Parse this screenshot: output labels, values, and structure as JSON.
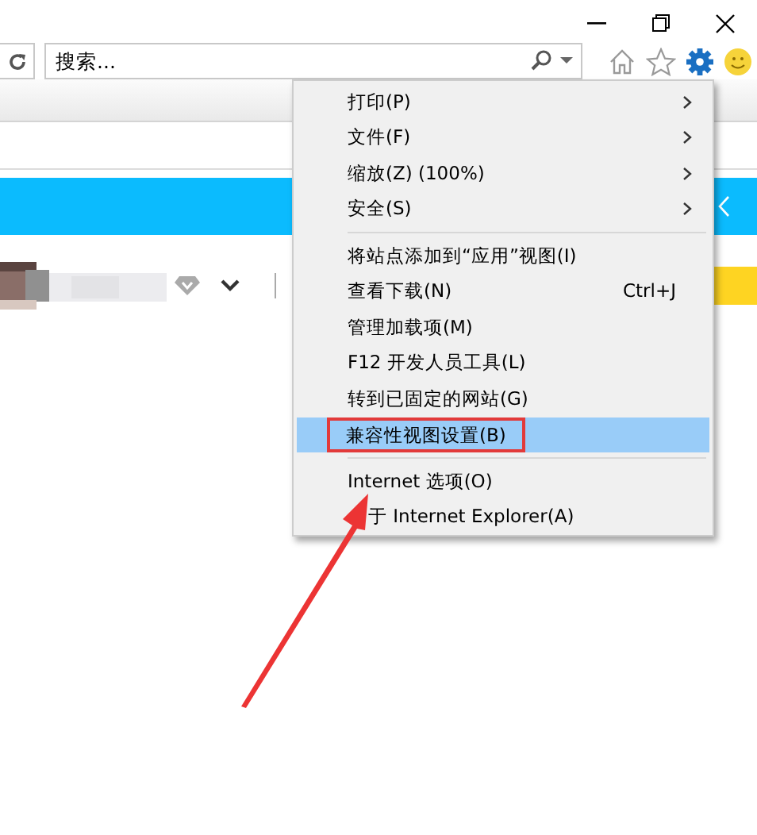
{
  "search": {
    "placeholder": "搜索..."
  },
  "menu": [
    {
      "kind": "item",
      "label": "打印(P)",
      "submenu": true,
      "selected": false
    },
    {
      "kind": "item",
      "label": "文件(F)",
      "submenu": true,
      "selected": false
    },
    {
      "kind": "item",
      "label": "缩放(Z) (100%)",
      "submenu": true,
      "selected": false
    },
    {
      "kind": "item",
      "label": "安全(S)",
      "submenu": true,
      "selected": false
    },
    {
      "kind": "separator"
    },
    {
      "kind": "item",
      "label": "将站点添加到“应用”视图(I)",
      "submenu": false,
      "selected": false
    },
    {
      "kind": "item",
      "label": "查看下载(N)",
      "shortcut": "Ctrl+J",
      "submenu": false,
      "selected": false
    },
    {
      "kind": "item",
      "label": "管理加载项(M)",
      "submenu": false,
      "selected": false
    },
    {
      "kind": "item",
      "label": "F12 开发人员工具(L)",
      "submenu": false,
      "selected": false
    },
    {
      "kind": "item",
      "label": "转到已固定的网站(G)",
      "submenu": false,
      "selected": false
    },
    {
      "kind": "item",
      "label": "兼容性视图设置(B)",
      "submenu": false,
      "selected": true,
      "outlined": true
    },
    {
      "kind": "separator"
    },
    {
      "kind": "item",
      "label": "Internet 选项(O)",
      "submenu": false,
      "selected": false
    },
    {
      "kind": "item",
      "label": "于 Internet Explorer(A)",
      "submenu": false,
      "selected": false,
      "obscured": true
    }
  ]
}
